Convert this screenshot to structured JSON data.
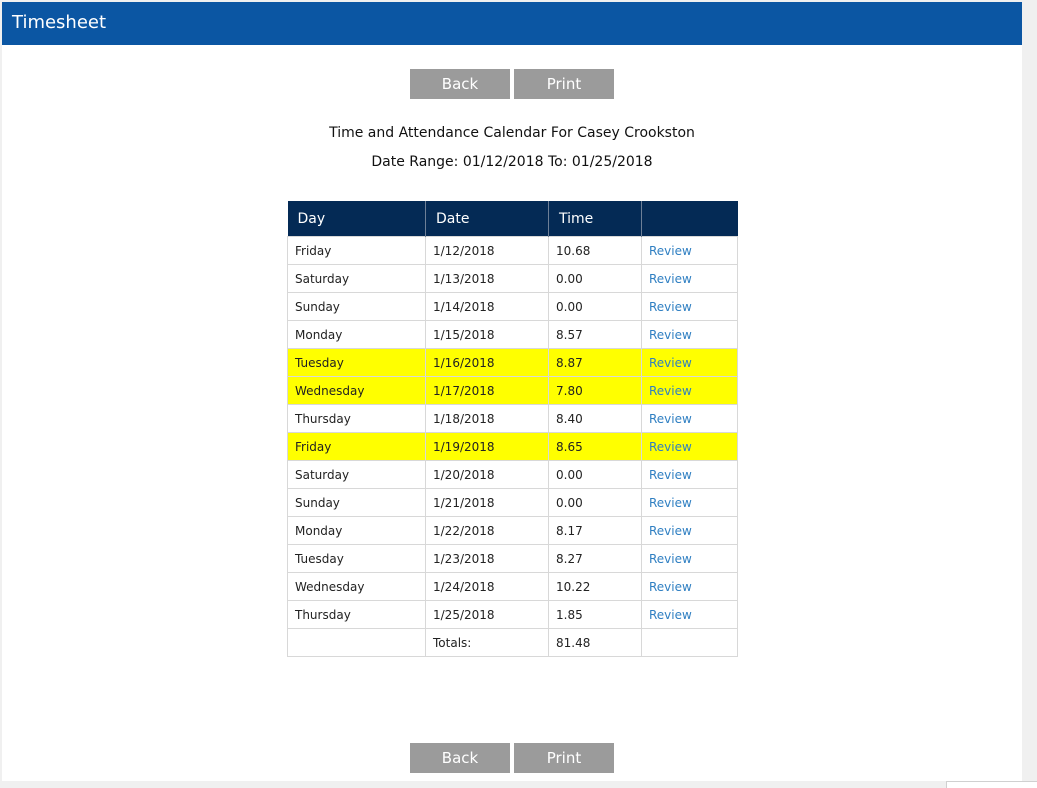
{
  "header": {
    "title": "Timesheet"
  },
  "buttons": {
    "back": "Back",
    "print": "Print"
  },
  "report": {
    "title": "Time and Attendance Calendar For Casey Crookston",
    "date_range": "Date Range: 01/12/2018 To: 01/25/2018"
  },
  "table": {
    "columns": [
      "Day",
      "Date",
      "Time",
      ""
    ],
    "rows": [
      {
        "day": "Friday",
        "date": "1/12/2018",
        "time": "10.68",
        "action": "Review",
        "highlight": false
      },
      {
        "day": "Saturday",
        "date": "1/13/2018",
        "time": "0.00",
        "action": "Review",
        "highlight": false
      },
      {
        "day": "Sunday",
        "date": "1/14/2018",
        "time": "0.00",
        "action": "Review",
        "highlight": false
      },
      {
        "day": "Monday",
        "date": "1/15/2018",
        "time": "8.57",
        "action": "Review",
        "highlight": false
      },
      {
        "day": "Tuesday",
        "date": "1/16/2018",
        "time": "8.87",
        "action": "Review",
        "highlight": true
      },
      {
        "day": "Wednesday",
        "date": "1/17/2018",
        "time": "7.80",
        "action": "Review",
        "highlight": true
      },
      {
        "day": "Thursday",
        "date": "1/18/2018",
        "time": "8.40",
        "action": "Review",
        "highlight": false
      },
      {
        "day": "Friday",
        "date": "1/19/2018",
        "time": "8.65",
        "action": "Review",
        "highlight": true
      },
      {
        "day": "Saturday",
        "date": "1/20/2018",
        "time": "0.00",
        "action": "Review",
        "highlight": false
      },
      {
        "day": "Sunday",
        "date": "1/21/2018",
        "time": "0.00",
        "action": "Review",
        "highlight": false
      },
      {
        "day": "Monday",
        "date": "1/22/2018",
        "time": "8.17",
        "action": "Review",
        "highlight": false
      },
      {
        "day": "Tuesday",
        "date": "1/23/2018",
        "time": "8.27",
        "action": "Review",
        "highlight": false
      },
      {
        "day": "Wednesday",
        "date": "1/24/2018",
        "time": "10.22",
        "action": "Review",
        "highlight": false
      },
      {
        "day": "Thursday",
        "date": "1/25/2018",
        "time": "1.85",
        "action": "Review",
        "highlight": false
      }
    ],
    "totals": {
      "label": "Totals:",
      "value": "81.48"
    }
  },
  "colors": {
    "header_bg": "#0b56a3",
    "table_header_bg": "#042a55",
    "highlight": "#ffff00",
    "button_bg": "#9b9b9b",
    "link": "#2f7fc2"
  }
}
